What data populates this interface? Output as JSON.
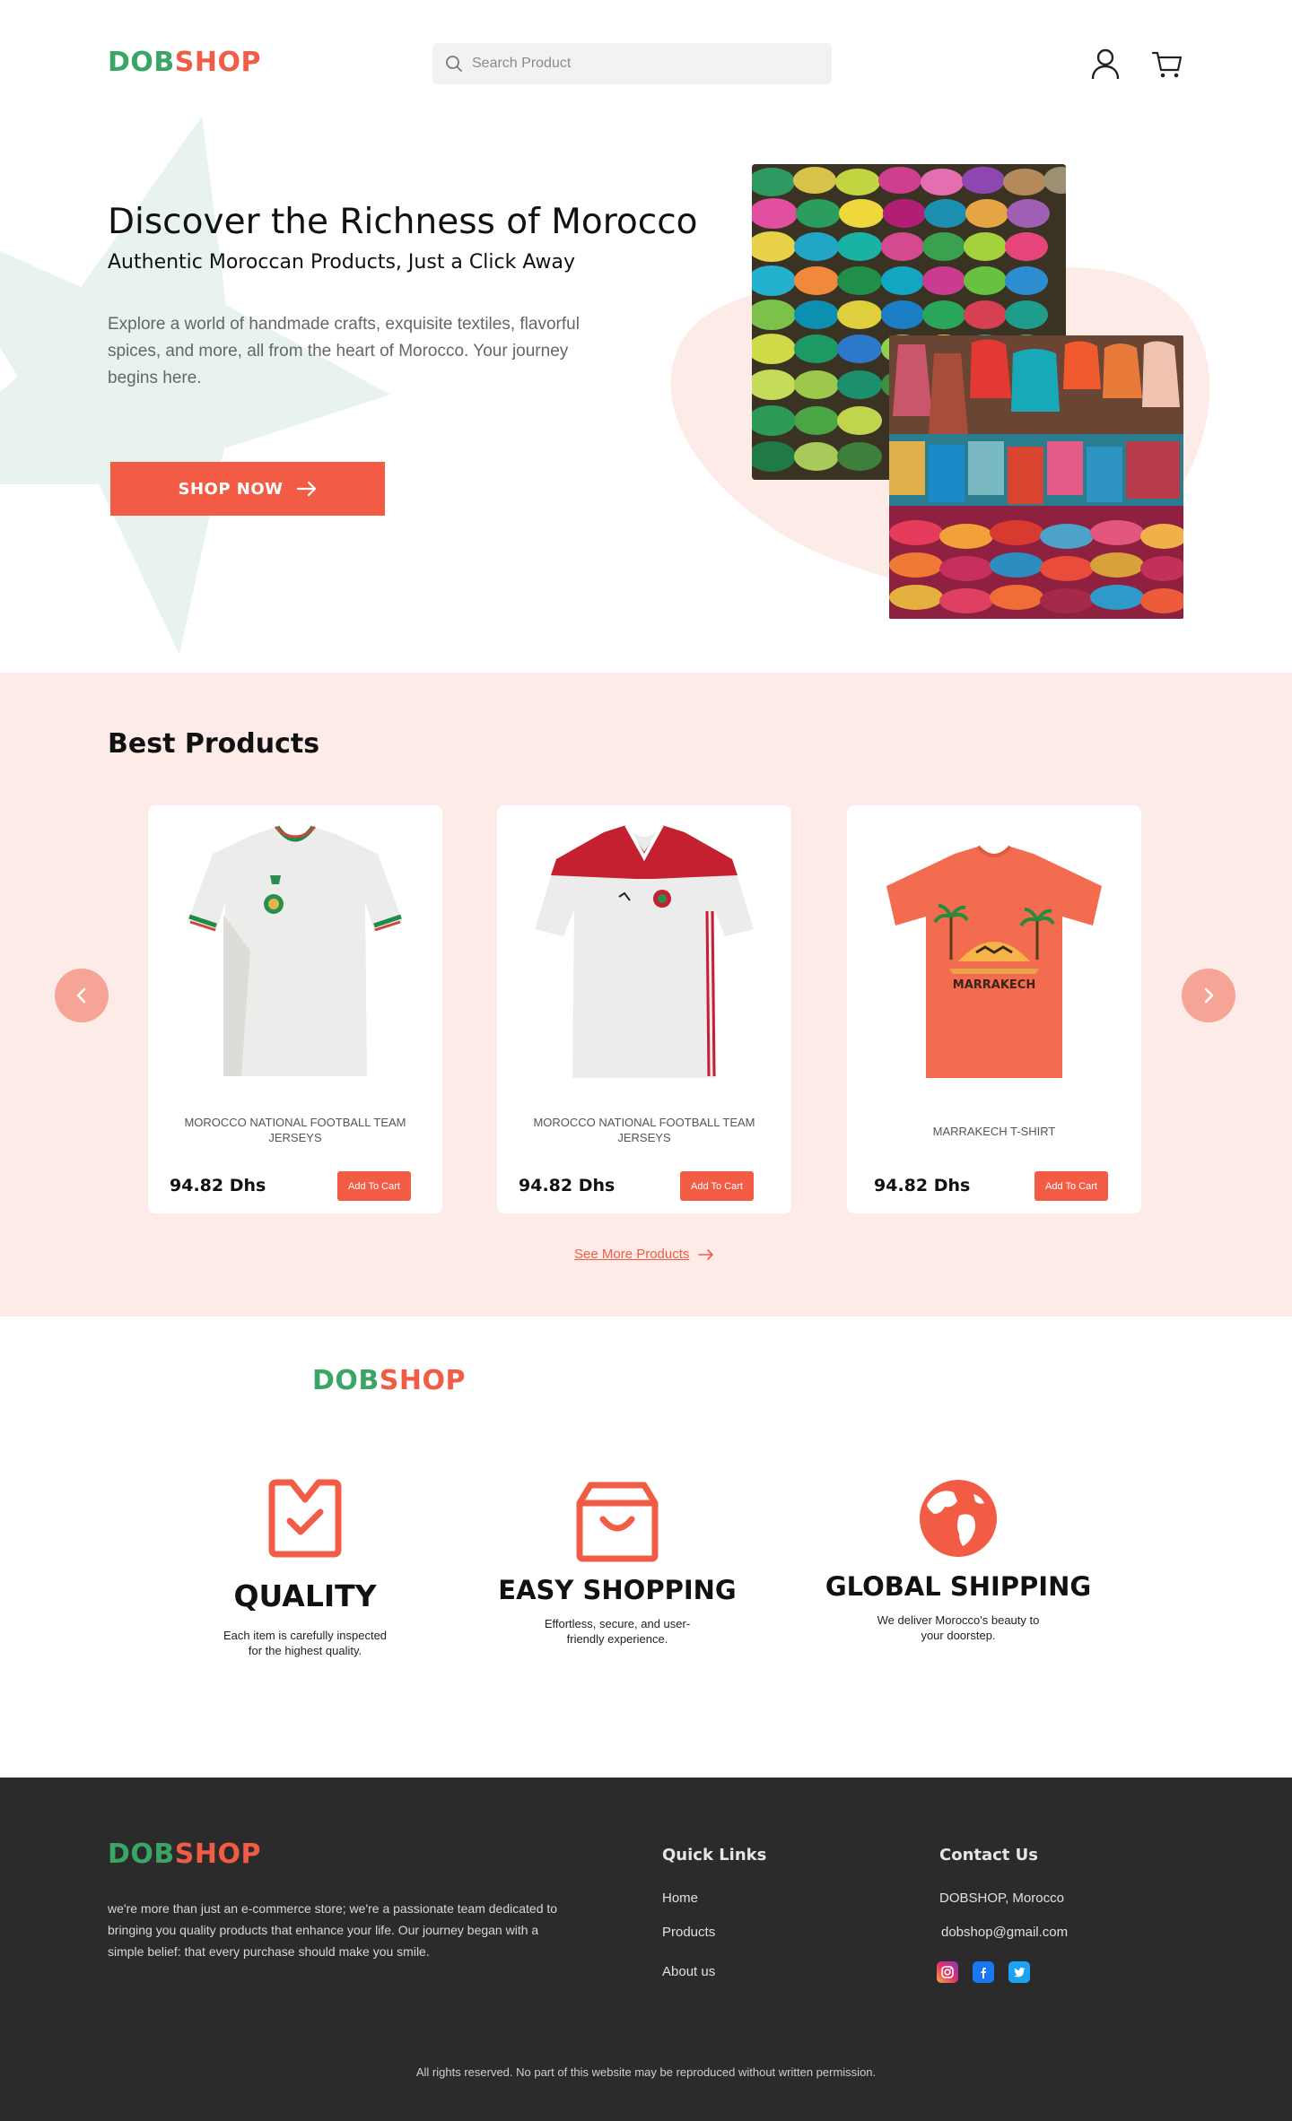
{
  "header": {
    "brand": {
      "part1": "DOB",
      "part2": "SHOP"
    },
    "search_placeholder": "Search Product"
  },
  "hero": {
    "title": "Discover the Richness of Morocco",
    "subtitle": "Authentic Moroccan Products, Just a Click Away",
    "description": "Explore a world of handmade crafts, exquisite textiles, flavorful spices, and more, all from the heart of Morocco. Your journey begins here.",
    "cta_label": "SHOP NOW"
  },
  "best_products": {
    "title": "Best Products",
    "products": [
      {
        "name": "MOROCCO NATIONAL FOOTBALL TEAM JERSEYS",
        "price": "94.82 Dhs",
        "button": "Add To Cart"
      },
      {
        "name": "MOROCCO NATIONAL FOOTBALL TEAM JERSEYS",
        "price": "94.82 Dhs",
        "button": "Add To Cart"
      },
      {
        "name": "MARRAKECH T-SHIRT",
        "price": "94.82 Dhs",
        "button": "Add To Cart",
        "print_text": "MARRAKECH"
      }
    ],
    "see_more": "See More Products"
  },
  "features": {
    "brand": {
      "part1": "DOB",
      "part2": "SHOP"
    },
    "items": [
      {
        "title": "QUALITY",
        "description": "Each item is carefully inspected for the highest quality."
      },
      {
        "title": "EASY SHOPPING",
        "description": "Effortless, secure, and user-friendly experience."
      },
      {
        "title": "GLOBAL SHIPPING",
        "description": "We deliver Morocco's beauty to your doorstep."
      }
    ]
  },
  "footer": {
    "brand": {
      "part1": "DOB",
      "part2": "SHOP"
    },
    "about": "we're more than just an e-commerce store; we're a passionate team dedicated to bringing you quality products that enhance your life. Our journey began with a simple belief: that every purchase should make you smile.",
    "quick_links": {
      "title": "Quick Links",
      "items": [
        "Home",
        "Products",
        "About us"
      ]
    },
    "contact": {
      "title": "Contact Us",
      "location": "DOBSHOP, Morocco",
      "email": "dobshop@gmail.com"
    },
    "copyright": "All rights reserved. No part of this website may be reproduced without written permission."
  },
  "colors": {
    "accent": "#f25c45",
    "brand_green": "#3aa565",
    "section_bg": "#fdebe8",
    "footer_bg": "#2b2b2b"
  },
  "icons": [
    "search-icon",
    "user-icon",
    "cart-icon",
    "arrow-right-icon",
    "chevron-left-icon",
    "chevron-right-icon",
    "quality-check-icon",
    "shopping-bag-icon",
    "globe-icon",
    "instagram-icon",
    "facebook-icon",
    "twitter-icon"
  ]
}
